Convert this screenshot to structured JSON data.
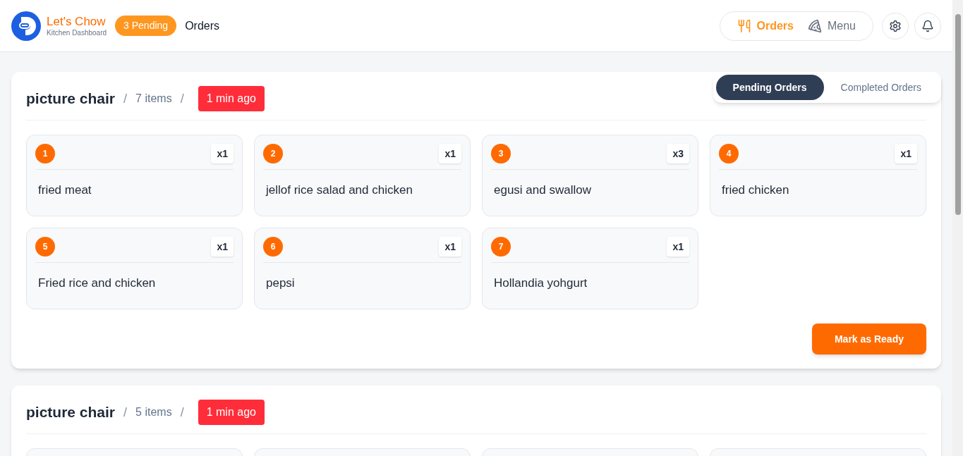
{
  "header": {
    "brand": "Let's Chow",
    "subtitle": "Kitchen Dashboard",
    "pending_badge": "3 Pending",
    "page_title": "Orders",
    "nav": [
      {
        "label": "Orders",
        "kind": "orders",
        "selected": true
      },
      {
        "label": "Menu",
        "kind": "menu",
        "selected": false
      }
    ]
  },
  "view_tabs": [
    {
      "label": "Pending Orders",
      "selected": true
    },
    {
      "label": "Completed Orders",
      "selected": false
    }
  ],
  "orders": [
    {
      "customer": "picture chair",
      "item_count": "7 items",
      "time": "1 min ago",
      "items": [
        {
          "number": "1",
          "quantity": "x1",
          "name": "fried meat"
        },
        {
          "number": "2",
          "quantity": "x1",
          "name": "jellof rice salad and chicken"
        },
        {
          "number": "3",
          "quantity": "x3",
          "name": "egusi and swallow"
        },
        {
          "number": "4",
          "quantity": "x1",
          "name": "fried chicken"
        },
        {
          "number": "5",
          "quantity": "x1",
          "name": "Fried rice and chicken"
        },
        {
          "number": "6",
          "quantity": "x1",
          "name": "pepsi"
        },
        {
          "number": "7",
          "quantity": "x1",
          "name": "Hollandia yohgurt"
        }
      ],
      "action": "Mark as Ready",
      "separators": [
        "/",
        "/"
      ]
    },
    {
      "customer": "picture chair",
      "item_count": "5 items",
      "time": "1 min ago",
      "separators": [
        "/",
        "/"
      ]
    }
  ]
}
